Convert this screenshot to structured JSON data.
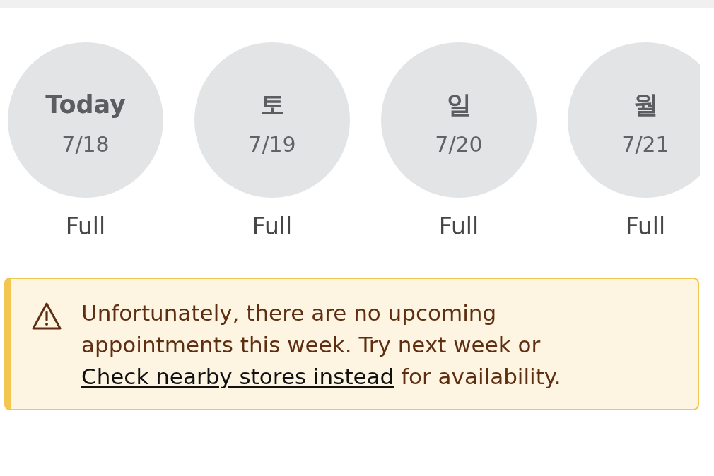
{
  "days": [
    {
      "day": "Today",
      "date": "7/18",
      "status": "Full"
    },
    {
      "day": "토",
      "date": "7/19",
      "status": "Full"
    },
    {
      "day": "일",
      "date": "7/20",
      "status": "Full"
    },
    {
      "day": "월",
      "date": "7/21",
      "status": "Full"
    }
  ],
  "alert": {
    "kind": "warning",
    "text_before": "Unfortunately, there are no upcoming appointments this week. Try next week or",
    "link": "Check nearby stores instead",
    "text_after": "for availability."
  }
}
